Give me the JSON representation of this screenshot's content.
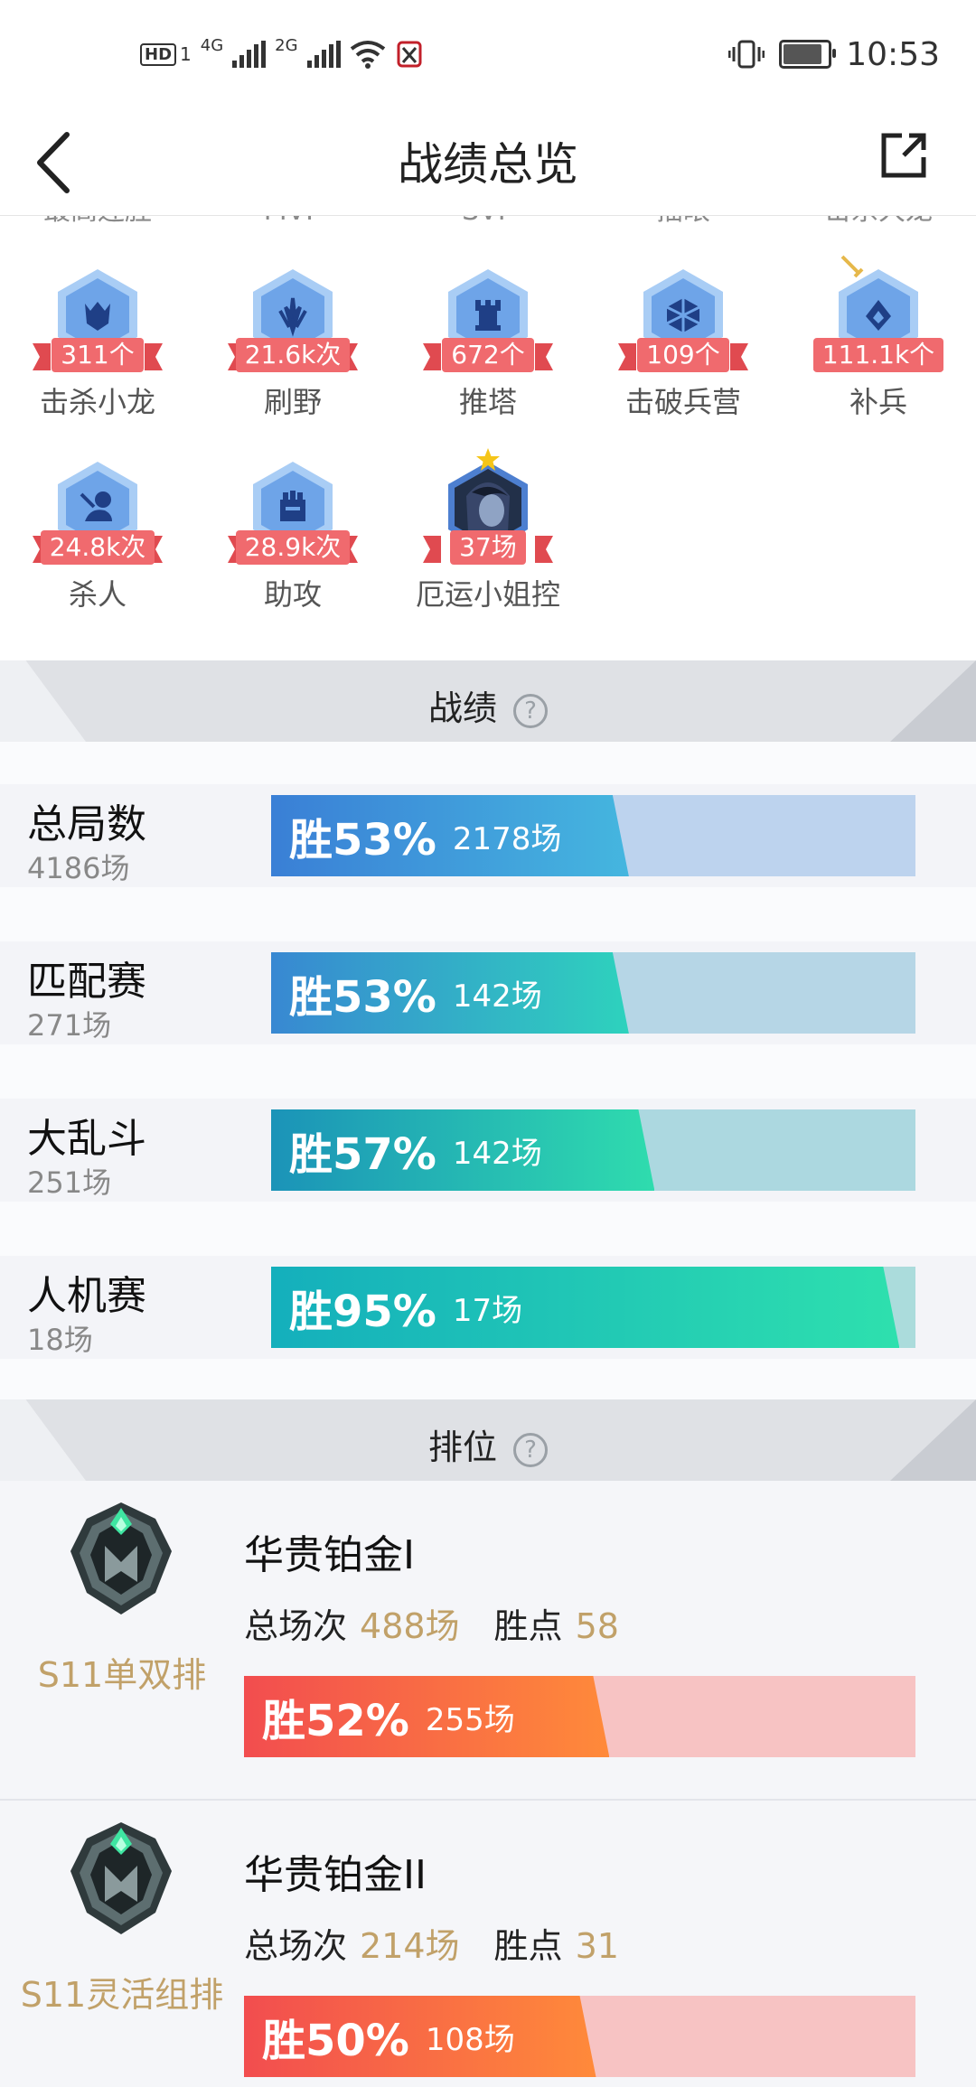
{
  "status_bar": {
    "hd_label": "HD",
    "hd_sub": "1",
    "network1": "4G",
    "network2": "2G",
    "time": "10:53"
  },
  "header": {
    "title": "战绩总览"
  },
  "achievements_cutoff": [
    "最高连胜",
    "MVP",
    "SVP",
    "插眼",
    "击杀大龙"
  ],
  "achievements": [
    {
      "count": "311个",
      "label": "击杀小龙",
      "icon": "dragon-icon"
    },
    {
      "count": "21.6k次",
      "label": "刷野",
      "icon": "jungle-icon"
    },
    {
      "count": "672个",
      "label": "推塔",
      "icon": "tower-icon"
    },
    {
      "count": "109个",
      "label": "击破兵营",
      "icon": "inhibitor-icon"
    },
    {
      "count": "111.1k个",
      "label": "补兵",
      "icon": "minion-icon"
    },
    {
      "count": "24.8k次",
      "label": "杀人",
      "icon": "kill-icon"
    },
    {
      "count": "28.9k次",
      "label": "助攻",
      "icon": "assist-icon"
    },
    {
      "count": "37场",
      "label": "厄运小姐控",
      "icon": "champion-portrait-icon"
    }
  ],
  "record_section": {
    "title": "战绩",
    "help_icon": "?",
    "rows": [
      {
        "name": "总局数",
        "games": "4186场",
        "win_label": "胜53%",
        "win_games": "2178场",
        "win_rate": 0.53
      },
      {
        "name": "匹配赛",
        "games": "271场",
        "win_label": "胜53%",
        "win_games": "142场",
        "win_rate": 0.53
      },
      {
        "name": "大乱斗",
        "games": "251场",
        "win_label": "胜57%",
        "win_games": "142场",
        "win_rate": 0.57
      },
      {
        "name": "人机赛",
        "games": "18场",
        "win_label": "胜95%",
        "win_games": "17场",
        "win_rate": 0.95
      }
    ]
  },
  "ranked_section": {
    "title": "排位",
    "help_icon": "?",
    "queues": [
      {
        "queue": "S11单双排",
        "tier": "华贵铂金I",
        "total_label": "总场次",
        "total": "488场",
        "lp_label": "胜点",
        "lp": "58",
        "win_label": "胜52%",
        "win_games": "255场",
        "win_rate": 0.52
      },
      {
        "queue": "S11灵活组排",
        "tier": "华贵铂金II",
        "total_label": "总场次",
        "total": "214场",
        "lp_label": "胜点",
        "lp": "31",
        "win_label": "胜50%",
        "win_games": "108场",
        "win_rate": 0.5
      }
    ]
  },
  "colors": {
    "badge_blue": "#7fb3f0",
    "ribbon_red": "#f06a6e",
    "gold_text": "#c1a169",
    "rank_bar_start": "#f24d4f",
    "rank_bar_end": "#ff8a3a",
    "rank_track": "#f7c3c3"
  }
}
